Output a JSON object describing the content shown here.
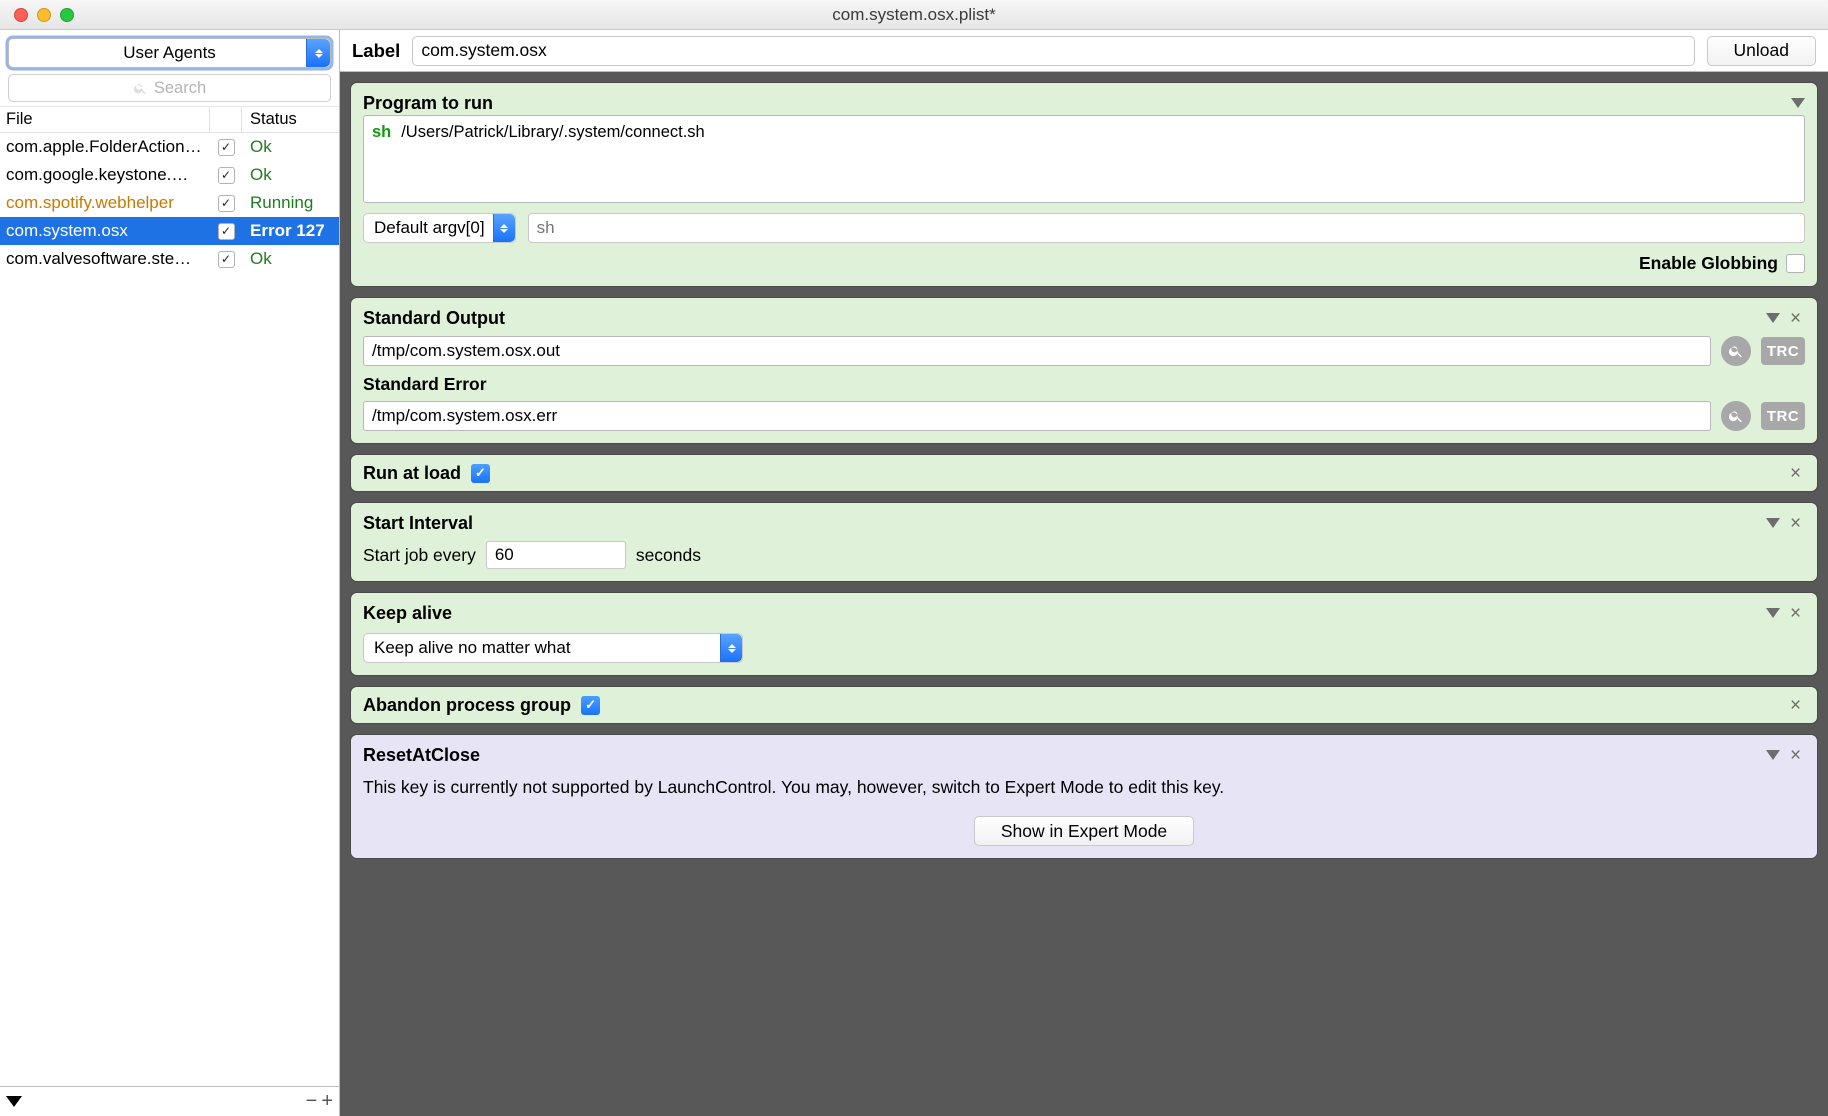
{
  "window": {
    "title": "com.system.osx.plist*"
  },
  "sidebar": {
    "scope": "User Agents",
    "search_placeholder": "Search",
    "columns": {
      "file": "File",
      "status": "Status"
    },
    "rows": [
      {
        "file": "com.apple.FolderAction…",
        "enabled": true,
        "status": "Ok",
        "status_class": "ok"
      },
      {
        "file": "com.google.keystone.…",
        "enabled": true,
        "status": "Ok",
        "status_class": "ok"
      },
      {
        "file": "com.spotify.webhelper",
        "enabled": true,
        "status": "Running",
        "status_class": "running",
        "warn": true
      },
      {
        "file": "com.system.osx",
        "enabled": true,
        "status": "Error 127",
        "status_class": "err",
        "selected": true
      },
      {
        "file": "com.valvesoftware.ste…",
        "enabled": true,
        "status": "Ok",
        "status_class": "ok"
      }
    ]
  },
  "topbar": {
    "label": "Label",
    "value": "com.system.osx",
    "action": "Unload"
  },
  "cards": {
    "program": {
      "title": "Program to run",
      "interpreter": "sh",
      "path": "/Users/Patrick/Library/.system/connect.sh",
      "argv_mode": "Default argv[0]",
      "argv_placeholder": "sh",
      "globbing_label": "Enable Globbing"
    },
    "stdout": {
      "title": "Standard Output",
      "path": "/tmp/com.system.osx.out",
      "trc": "TRC"
    },
    "stderr": {
      "title": "Standard Error",
      "path": "/tmp/com.system.osx.err",
      "trc": "TRC"
    },
    "runatload": {
      "title": "Run at load"
    },
    "interval": {
      "title": "Start Interval",
      "prefix": "Start job every",
      "value": "60",
      "suffix": "seconds"
    },
    "keepalive": {
      "title": "Keep alive",
      "mode": "Keep alive no matter what"
    },
    "abandon": {
      "title": "Abandon process group"
    },
    "reset": {
      "title": "ResetAtClose",
      "desc": "This key is currently not supported by LaunchControl. You may, however, switch to Expert Mode to edit this key.",
      "button": "Show in Expert Mode"
    }
  }
}
